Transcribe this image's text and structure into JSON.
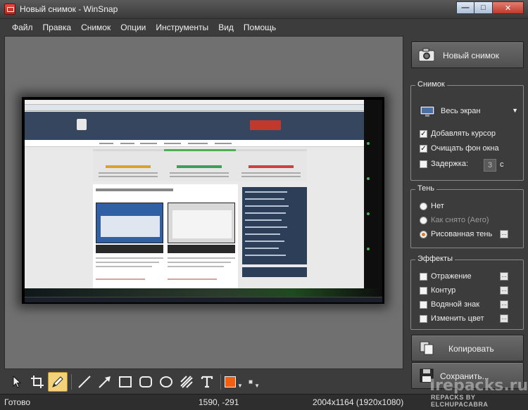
{
  "window": {
    "title": "Новый снимок - WinSnap",
    "minimize_glyph": "—",
    "maximize_glyph": "□",
    "close_glyph": "✕"
  },
  "menu": [
    "Файл",
    "Правка",
    "Снимок",
    "Опции",
    "Инструменты",
    "Вид",
    "Помощь"
  ],
  "panel": {
    "new_shot_label": "Новый снимок",
    "snapshot_group": {
      "title": "Снимок",
      "mode_value": "Весь экран",
      "add_cursor": "Добавлять курсор",
      "clear_bg": "Очищать фон окна",
      "delay_label": "Задержка:",
      "delay_value": "3",
      "delay_unit": "с"
    },
    "shadow_group": {
      "title": "Тень",
      "options": [
        "Нет",
        "Как снято (Aero)",
        "Рисованная тень"
      ],
      "selected": "Рисованная тень"
    },
    "effects_group": {
      "title": "Эффекты",
      "options": [
        "Отражение",
        "Контур",
        "Водяной знак",
        "Изменить цвет"
      ]
    },
    "copy_label": "Копировать",
    "save_label": "Сохранить..."
  },
  "toolbar": {
    "tools": [
      "pointer-icon",
      "crop-icon",
      "pen-icon",
      "line-icon",
      "arrow-icon",
      "rectangle-icon",
      "rounded-rectangle-icon",
      "ellipse-icon",
      "hatch-icon",
      "text-icon"
    ],
    "active_tool": "pen-icon",
    "color": "#f06010"
  },
  "status": {
    "state": "Готово",
    "coords": "1590, -291",
    "size": "2004x1164 (1920x1080)"
  },
  "watermark": {
    "site": "Irepacks.ru",
    "credit": "REPACKS BY ELCHUPACABRA"
  }
}
